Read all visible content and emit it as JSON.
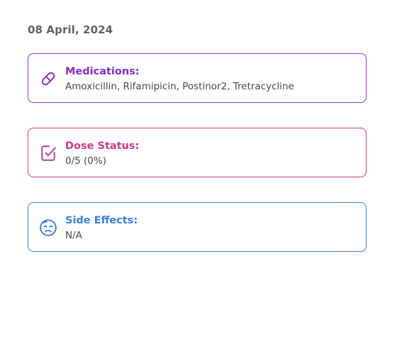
{
  "date": "08 April, 2024",
  "cards": {
    "medications": {
      "title": "Medications:",
      "value": "Amoxicillin, Rifamipicin, Postinor2, Tretracycline",
      "icon": "pill-icon",
      "color": "#9b30d9"
    },
    "dose_status": {
      "title": "Dose Status:",
      "value": "0/5 (0%)",
      "icon": "checkbox-icon",
      "color": "#cc3c8f"
    },
    "side_effects": {
      "title": "Side Effects:",
      "value": "N/A",
      "icon": "sick-face-icon",
      "color": "#3b7fe6"
    }
  }
}
